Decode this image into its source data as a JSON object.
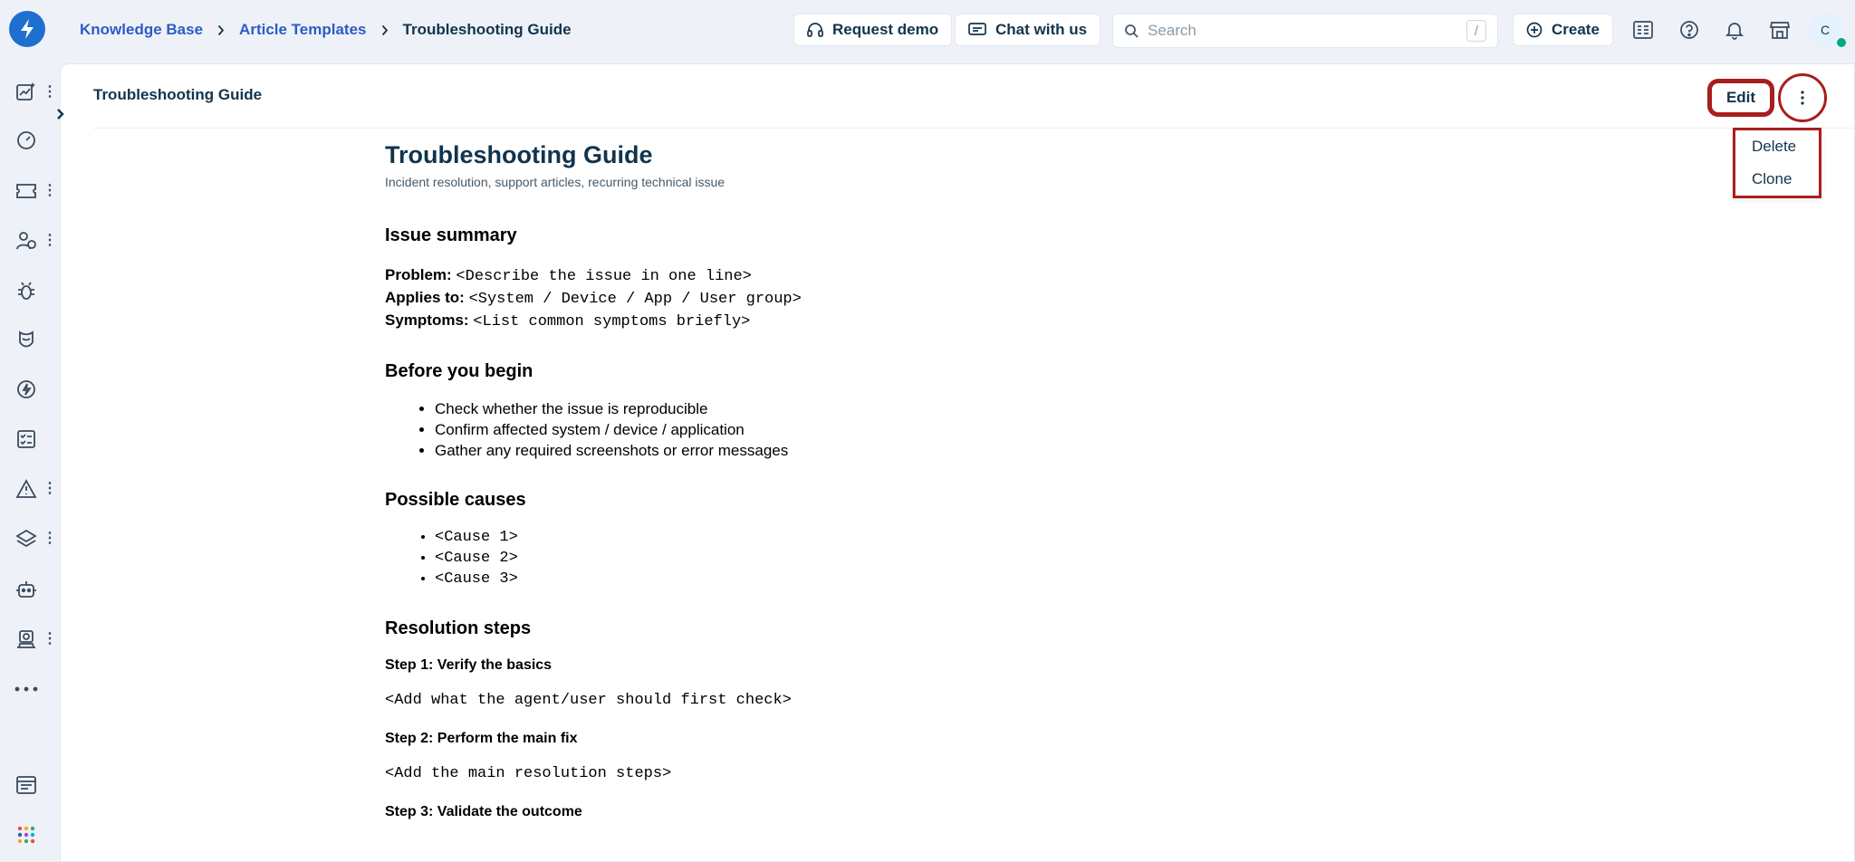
{
  "breadcrumb": {
    "items": [
      "Knowledge Base",
      "Article Templates"
    ],
    "current": "Troubleshooting Guide"
  },
  "topbar": {
    "request_demo": "Request demo",
    "chat": "Chat with us",
    "search_placeholder": "Search",
    "search_shortcut": "/",
    "create": "Create",
    "avatar_initial": "C"
  },
  "page": {
    "header_title": "Troubleshooting Guide",
    "edit_label": "Edit",
    "menu": [
      "Delete",
      "Clone"
    ]
  },
  "article": {
    "title": "Troubleshooting Guide",
    "subtitle": "Incident resolution, support articles, recurring technical issue",
    "issue_summary": {
      "heading": "Issue summary",
      "rows": [
        {
          "label": "Problem:",
          "value": "<Describe the issue in one line>"
        },
        {
          "label": "Applies to:",
          "value": "<System / Device / App / User group>"
        },
        {
          "label": "Symptoms:",
          "value": "<List common symptoms briefly>"
        }
      ]
    },
    "before": {
      "heading": "Before you begin",
      "items": [
        "Check whether the issue is reproducible",
        "Confirm affected system / device / application",
        "Gather any required screenshots or error messages"
      ]
    },
    "causes": {
      "heading": "Possible causes",
      "items": [
        "<Cause 1>",
        "<Cause 2>",
        "<Cause 3>"
      ]
    },
    "resolution": {
      "heading": "Resolution steps",
      "steps": [
        {
          "title": "Step 1: Verify the basics",
          "body": "<Add what the agent/user should first check>"
        },
        {
          "title": "Step 2: Perform the main fix",
          "body": "<Add the main resolution steps>"
        },
        {
          "title": "Step 3: Validate the outcome",
          "body": ""
        }
      ]
    }
  },
  "colors": {
    "accent": "#2c5cc5",
    "highlight": "#a81e1e",
    "presence": "#00a886"
  }
}
